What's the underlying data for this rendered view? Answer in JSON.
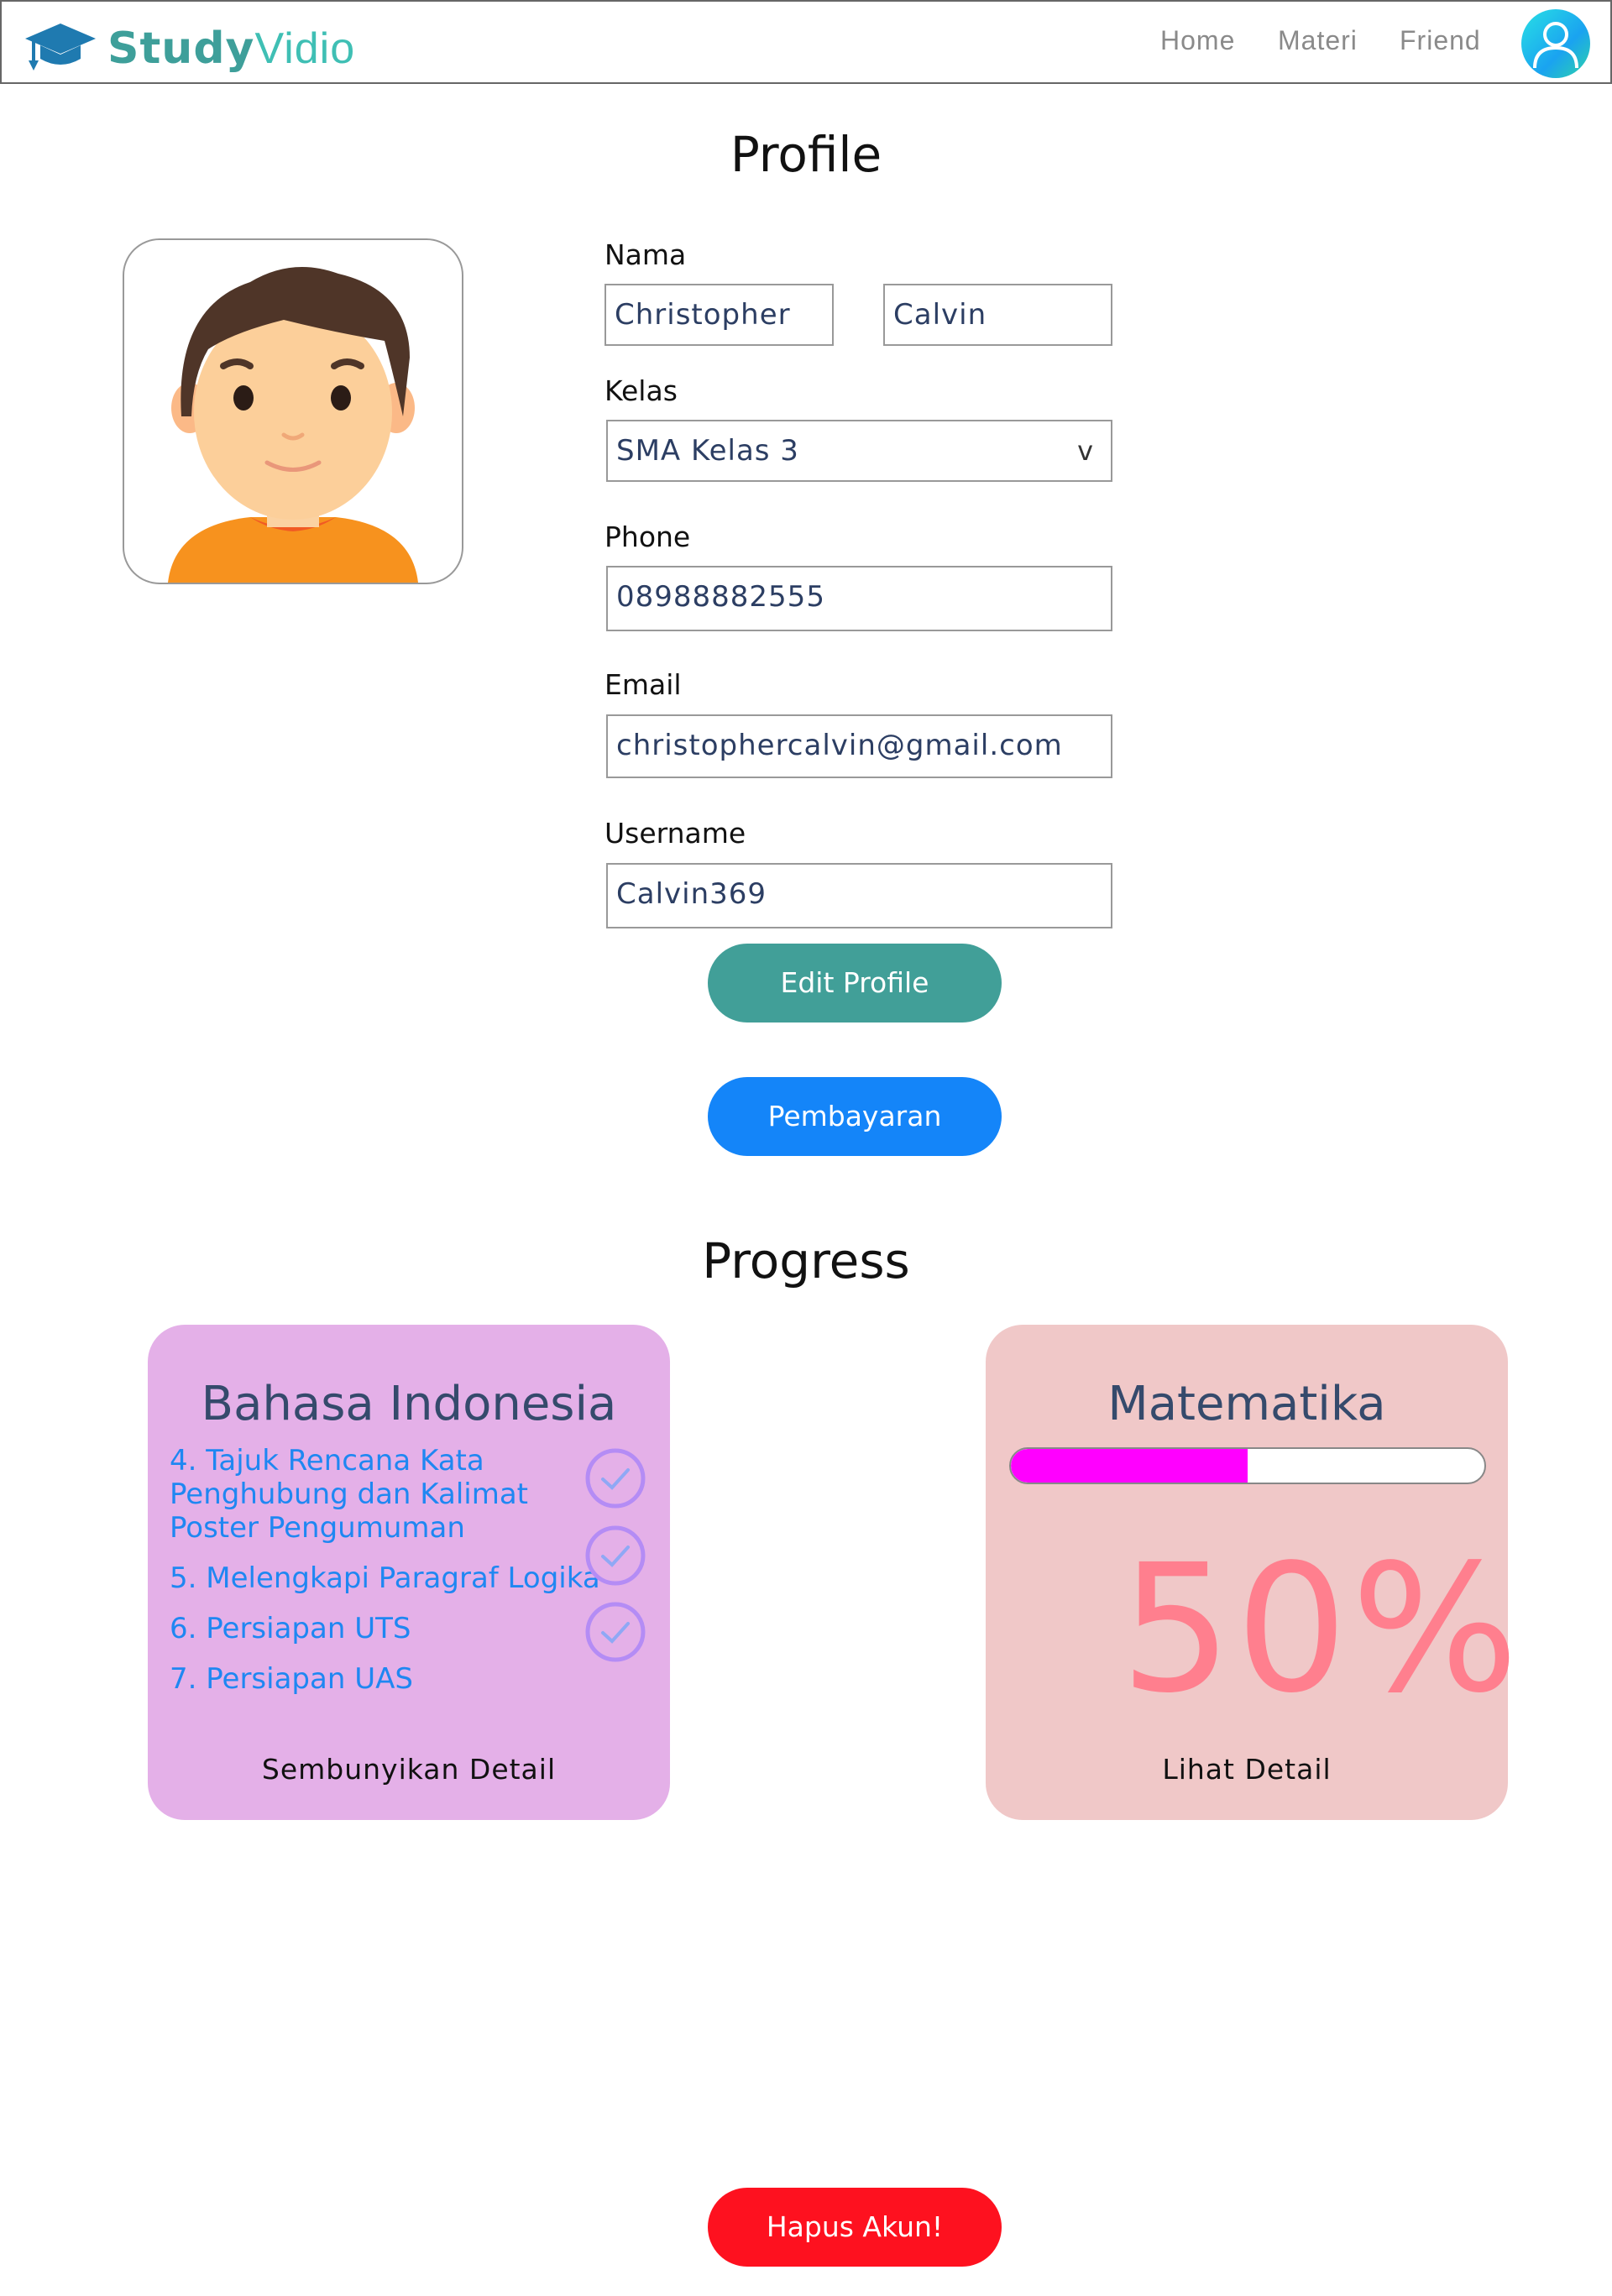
{
  "header": {
    "brand_study": "Study",
    "brand_vidio": "Vidio",
    "nav": [
      "Home",
      "Materi",
      "Friend"
    ]
  },
  "profile": {
    "title": "Profile",
    "nama_label": "Nama",
    "first_name": "Christopher",
    "last_name": "Calvin",
    "kelas_label": "Kelas",
    "kelas_value": "SMA Kelas 3",
    "kelas_arrow": "v",
    "phone_label": "Phone",
    "phone_value": "08988882555",
    "email_label": "Email",
    "email_value": "christophercalvin@gmail.com",
    "username_label": "Username",
    "username_value": "Calvin369",
    "edit_button": "Edit Profile",
    "payment_button": "Pembayaran"
  },
  "progress": {
    "title": "Progress",
    "card1": {
      "title": "Bahasa Indonesia",
      "lessons": [
        "4. Tajuk Rencana Kata Penghubung dan Kalimat Poster Pengumuman",
        "5. Melengkapi Paragraf Logika",
        "6. Persiapan UTS",
        "7. Persiapan UAS"
      ],
      "footer": "Sembunyikan Detail"
    },
    "card2": {
      "title": "Matematika",
      "progress_fraction": 0.5,
      "percent_text": "50%",
      "footer": "Lihat Detail"
    }
  },
  "delete_button": "Hapus Akun!",
  "colors": {
    "teal_button": "#419f98",
    "blue_button": "#1485f9",
    "red_button": "#fe111f",
    "card1_bg": "#e4b0e8",
    "card2_bg": "#f0c8c8",
    "progress_fill": "#ff00ff"
  }
}
